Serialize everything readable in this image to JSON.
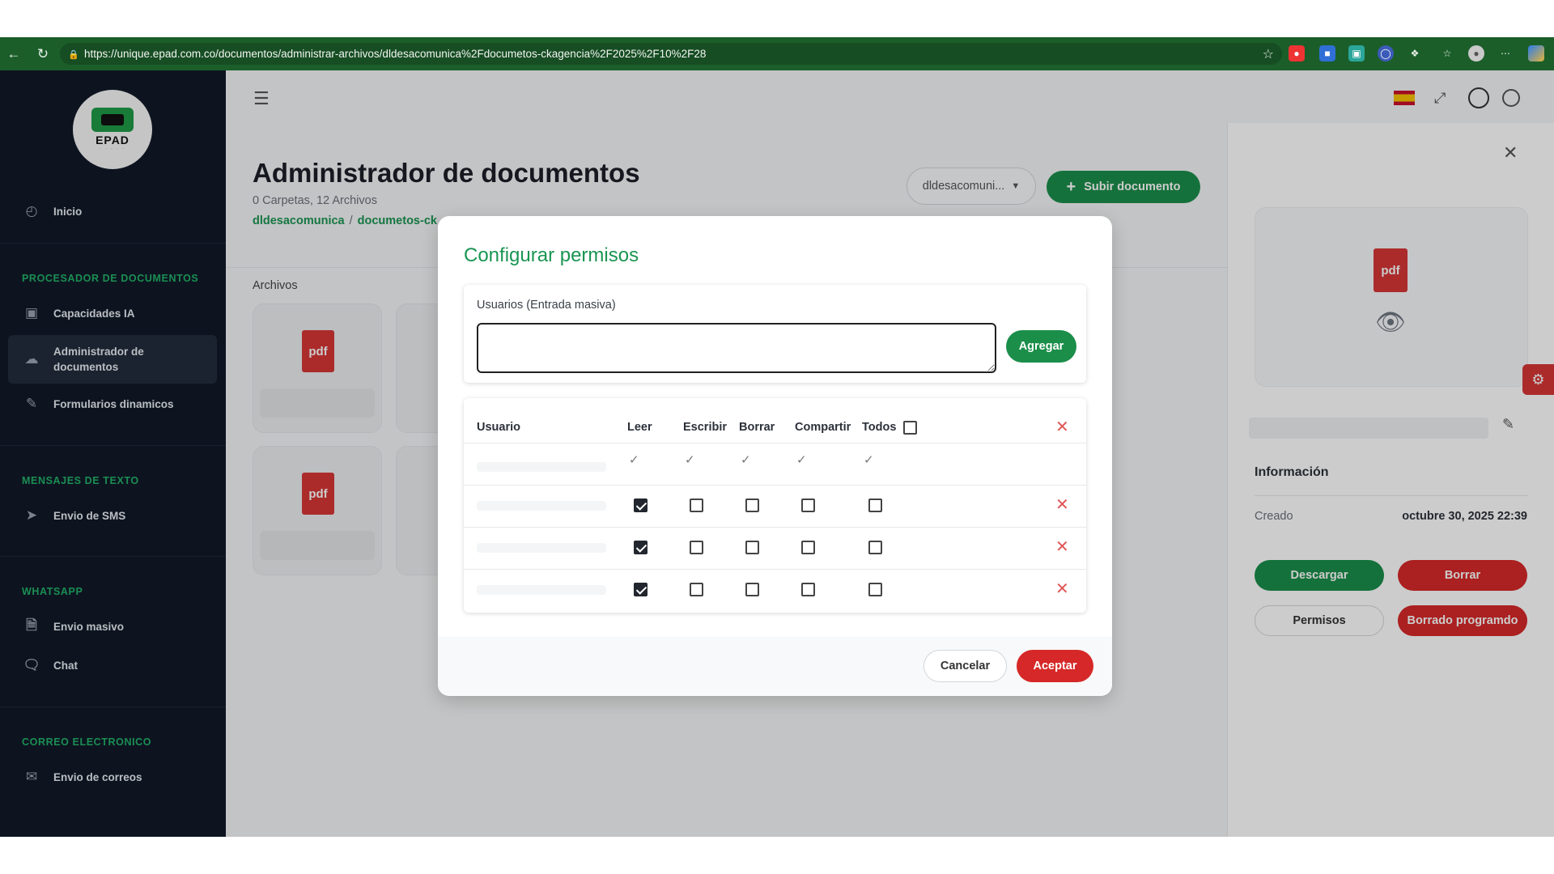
{
  "browser": {
    "url": "https://unique.epad.com.co/documentos/administrar-archivos/dldesacomunica%2Fdocumetos-ckagencia%2F2025%2F10%2F28"
  },
  "sidebar": {
    "logo_text": "EPAD",
    "logo_subtext": "· · · · ·",
    "items": [
      {
        "label": "Inicio",
        "icon": "chart-pie-icon"
      }
    ],
    "sections": [
      {
        "title": "PROCESADOR DE DOCUMENTOS",
        "items": [
          {
            "label": "Capacidades IA",
            "icon": "chip-icon"
          },
          {
            "label": "Administrador de documentos",
            "icon": "cloud-icon",
            "active": true
          },
          {
            "label": "Formularios dinamicos",
            "icon": "edit-icon"
          }
        ]
      },
      {
        "title": "MENSAJES DE TEXTO",
        "items": [
          {
            "label": "Envio de SMS",
            "icon": "send-icon"
          }
        ]
      },
      {
        "title": "WHATSAPP",
        "items": [
          {
            "label": "Envio masivo",
            "icon": "file-upload-icon"
          },
          {
            "label": "Chat",
            "icon": "chat-icon"
          }
        ]
      },
      {
        "title": "CORREO ELECTRONICO",
        "items": [
          {
            "label": "Envio de correos",
            "icon": "mail-icon"
          }
        ]
      }
    ]
  },
  "main": {
    "title": "Administrador de documentos",
    "subtitle": "0 Carpetas, 12 Archivos",
    "breadcrumb": [
      "dldesacomunica",
      "documetos-ck"
    ],
    "dropdown_value": "dldesacomuni...",
    "upload_label": "Subir documento",
    "files_label": "Archivos",
    "file_icon_label": "pdf"
  },
  "right_panel": {
    "file_icon_label": "pdf",
    "info_title": "Información",
    "created_label": "Creado",
    "created_value": "octubre 30, 2025 22:39",
    "download_label": "Descargar",
    "delete_label": "Borrar",
    "permissions_label": "Permisos",
    "scheduled_delete_label": "Borrado programdo"
  },
  "modal": {
    "title": "Configurar permisos",
    "users_label": "Usuarios (Entrada masiva)",
    "users_value": "",
    "add_label": "Agregar",
    "columns": [
      "Usuario",
      "Leer",
      "Escribir",
      "Borrar",
      "Compartir",
      "Todos"
    ],
    "rows": [
      {
        "leer": true,
        "escribir": false,
        "borrar": false,
        "compartir": false,
        "todos": false
      },
      {
        "leer": true,
        "escribir": false,
        "borrar": false,
        "compartir": false,
        "todos": false
      },
      {
        "leer": true,
        "escribir": false,
        "borrar": false,
        "compartir": false,
        "todos": false
      }
    ],
    "cancel_label": "Cancelar",
    "accept_label": "Aceptar"
  },
  "colors": {
    "brand_green": "#1b8e4a",
    "danger_red": "#d62828",
    "sidebar_bg": "#111a28",
    "browser_bar": "#1b5e2a"
  }
}
